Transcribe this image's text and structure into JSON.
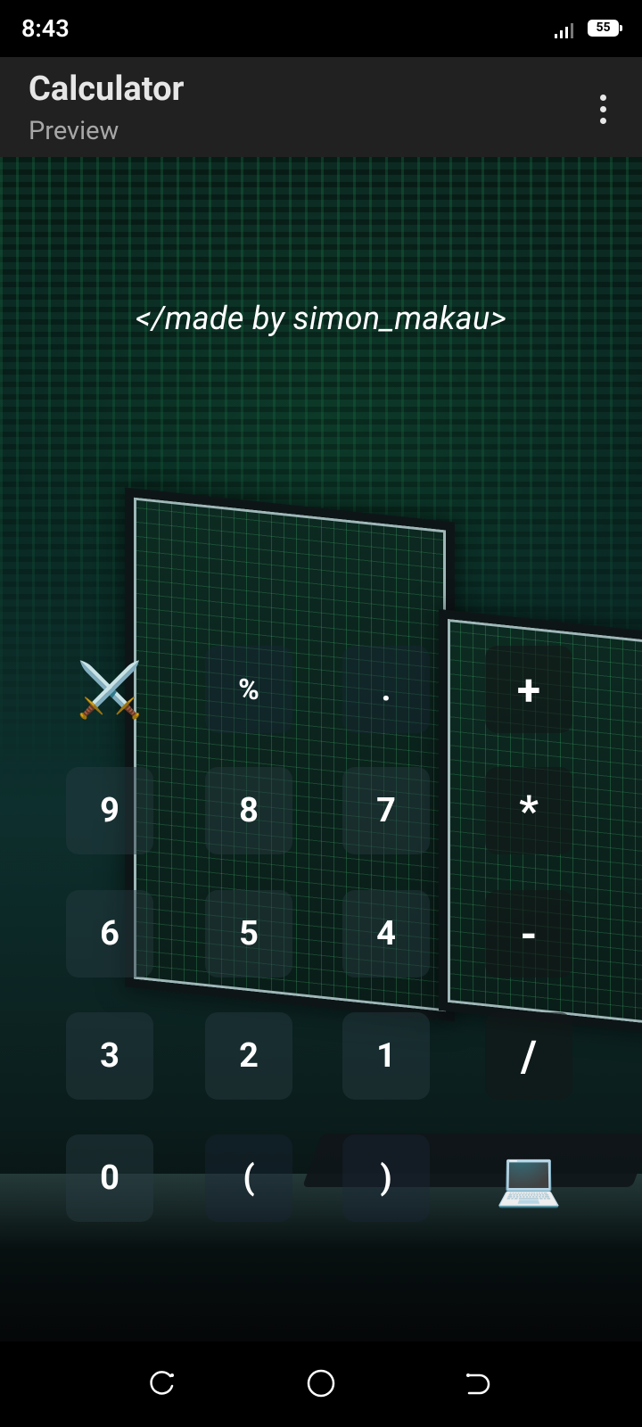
{
  "status_bar": {
    "time": "8:43",
    "battery": "55"
  },
  "app_bar": {
    "title": "Calculator",
    "subtitle": "Preview"
  },
  "credit_text": "</made by simon_makau>",
  "keypad": {
    "swords": "⚔️",
    "percent": "%",
    "dot": ".",
    "plus": "+",
    "nine": "9",
    "eight": "8",
    "seven": "7",
    "multiply": "*",
    "six": "6",
    "five": "5",
    "four": "4",
    "minus": "-",
    "three": "3",
    "two": "2",
    "one": "1",
    "divide": "/",
    "zero": "0",
    "open_paren": "(",
    "close_paren": ")",
    "laptop": "💻"
  },
  "icons": {
    "recent": "recent-apps-icon",
    "home": "home-icon",
    "back": "back-icon"
  }
}
